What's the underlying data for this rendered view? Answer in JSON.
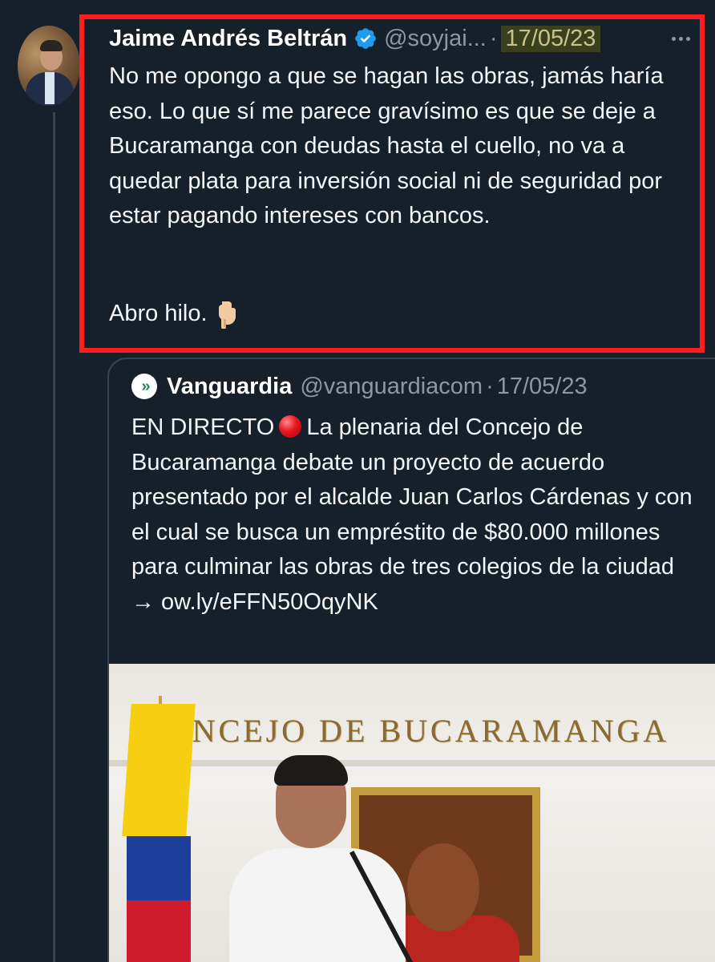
{
  "tweet": {
    "author_name": "Jaime Andrés Beltrán",
    "handle": "@soyjai...",
    "separator": "·",
    "date": "17/05/23",
    "text": "No me opongo a que se hagan las obras, jamás haría eso. Lo que sí me parece gravísimo es que se deje a Bucaramanga con deudas hasta el cuello, no va a quedar plata para inversión social ni de seguridad por estar pagando intereses con bancos.",
    "closing": "Abro hilo.",
    "closing_emoji": "backhand-index-pointing-down-icon",
    "highlight_color": "#ff1d1d"
  },
  "quoted_tweet": {
    "logo_text": "»",
    "author_name": "Vanguardia",
    "handle": "@vanguardiacom",
    "separator": "·",
    "date": "17/05/23",
    "text_prefix": "EN DIRECTO",
    "text_body": "La plenaria del Concejo de Bucaramanga debate un proyecto de acuerdo presentado por el alcalde Juan Carlos Cárdenas y con el cual se busca un empréstito de $80.000 millones para culminar las obras de tres colegios de la ciudad → ow.ly/eFFN50OqyNK",
    "image_sign": "CONCEJO DE BUCARAMANGA"
  },
  "colors": {
    "background": "#15202b",
    "verified": "#1d9bf0",
    "secondary_text": "#8b98a5"
  }
}
